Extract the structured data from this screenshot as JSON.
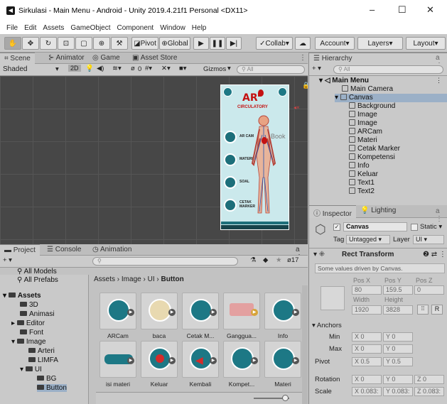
{
  "window": {
    "title": "Sirkulasi - Main Menu - Android - Unity 2019.4.21f1 Personal <DX11>",
    "min": "–",
    "max": "☐",
    "close": "✕"
  },
  "menu": [
    "File",
    "Edit",
    "Assets",
    "GameObject",
    "Component",
    "Window",
    "Help"
  ],
  "toolbar": {
    "pivot": "Pivot",
    "global": "Global",
    "collab": "Collab",
    "account": "Account",
    "layers": "Layers",
    "layout": "Layout"
  },
  "scene": {
    "tabs": [
      "Scene",
      "Animator",
      "Game",
      "Asset Store"
    ],
    "shading": "Shaded",
    "mode2d": "2D",
    "gizmos": "Gizmos",
    "search_placeholder": "All",
    "fx_count": "0",
    "game": {
      "title": "AR",
      "subtitle": "CIRCULATORY",
      "items": [
        "AR CAM",
        "MATERI",
        "SOAL",
        "CETAK MARKER"
      ],
      "side_label": "Book"
    }
  },
  "hierarchy": {
    "title": "Hierarchy",
    "search_placeholder": "All",
    "scene_name": "Main Menu",
    "camera": "Main Camera",
    "canvas": "Canvas",
    "children": [
      "Background",
      "Image",
      "Image",
      "ARCam",
      "Materi",
      "Cetak Marker",
      "Kompetensi",
      "Info",
      "Keluar",
      "Text1",
      "Text2"
    ]
  },
  "inspector": {
    "tabs": [
      "Inspector",
      "Lighting"
    ],
    "object_name": "Canvas",
    "static_label": "Static",
    "tag_label": "Tag",
    "tag_value": "Untagged",
    "layer_label": "Layer",
    "layer_value": "UI",
    "component": "Rect Transform",
    "note": "Some values driven by Canvas.",
    "pos_headers": [
      "Pos X",
      "Pos Y",
      "Pos Z"
    ],
    "pos_values": [
      "80",
      "159.5",
      "0"
    ],
    "size_headers": [
      "Width",
      "Height"
    ],
    "size_values": [
      "1920",
      "3828"
    ],
    "r_button": "R",
    "anchors_label": "Anchors",
    "min_label": "Min",
    "min_x": "0",
    "min_y": "0",
    "max_label": "Max",
    "max_x": "0",
    "max_y": "0",
    "pivot_label": "Pivot",
    "pivot_x": "0.5",
    "pivot_y": "0.5",
    "rotation_label": "Rotation",
    "rot_x": "0",
    "rot_y": "0",
    "rot_z": "0",
    "scale_label": "Scale",
    "scale_x": "0.083:",
    "scale_y": "0.083:",
    "scale_z": "0.083:"
  },
  "project": {
    "tabs": [
      "Project",
      "Console",
      "Animation"
    ],
    "search_placeholder": "",
    "hidden_count": "17",
    "breadcrumb": [
      "Assets",
      "Image",
      "UI",
      "Button"
    ],
    "favorites": [
      "All Models",
      "All Prefabs"
    ],
    "tree": [
      "Assets",
      "3D",
      "Animasi",
      "Editor",
      "Font",
      "Image",
      "Arteri",
      "LIMFA",
      "UI",
      "BG",
      "Button"
    ],
    "assets": [
      "ARCam",
      "baca",
      "Cetak M...",
      "Ganggua...",
      "Info",
      "isi materi",
      "Keluar",
      "Kembali",
      "Kompet...",
      "Materi"
    ]
  },
  "colors": {
    "accent": "#1d7885",
    "scene_bg": "#474747",
    "selection": "#9bb0c7"
  }
}
